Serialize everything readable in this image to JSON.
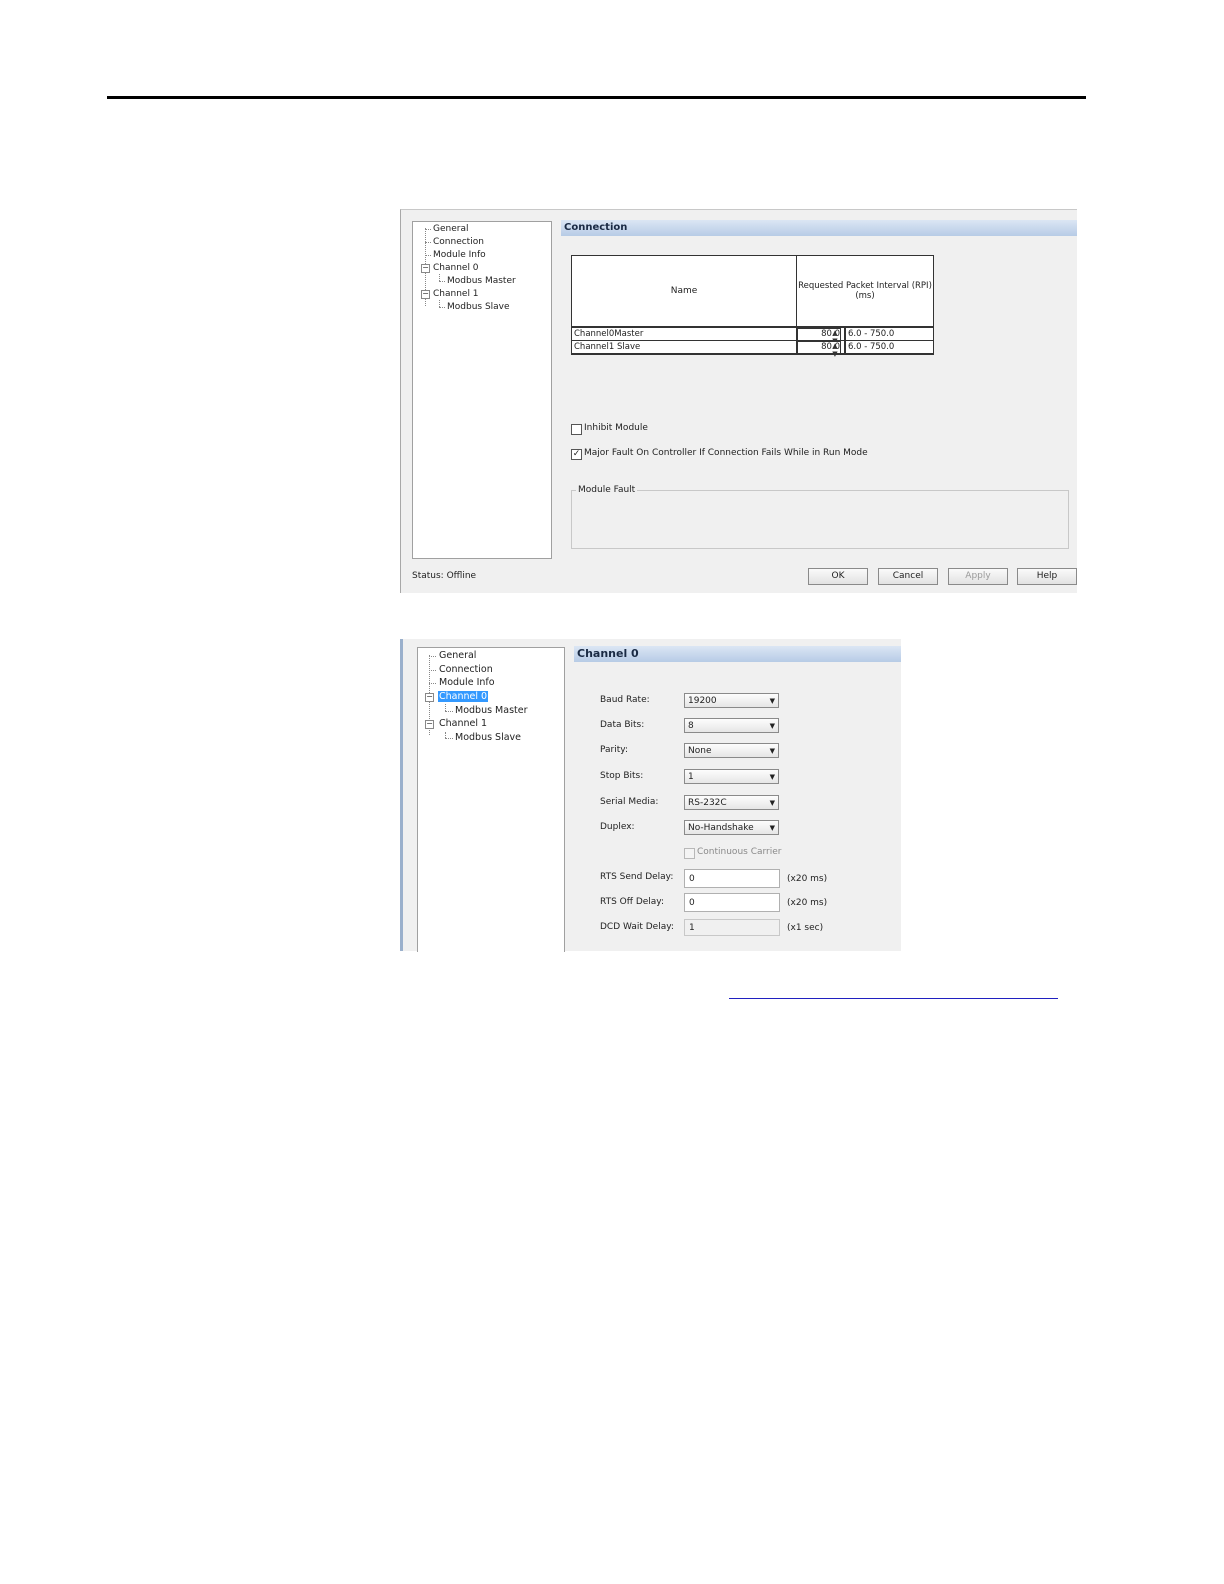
{
  "dialog1": {
    "tree": [
      {
        "label": "General"
      },
      {
        "label": "Connection"
      },
      {
        "label": "Module Info"
      },
      {
        "label": "Channel 0",
        "expander": "−"
      },
      {
        "label": "Modbus Master"
      },
      {
        "label": "Channel 1",
        "expander": "−"
      },
      {
        "label": "Modbus Slave"
      }
    ],
    "section_title": "Connection",
    "table": {
      "col_name": "Name",
      "col_rpi": "Requested Packet Interval (RPI)\n(ms)",
      "rows": [
        {
          "name": "Channel0Master",
          "value": "80.0",
          "range": "6.0 - 750.0"
        },
        {
          "name": "Channel1 Slave",
          "value": "80.0",
          "range": "6.0 - 750.0"
        }
      ]
    },
    "inhibit_label": "Inhibit Module",
    "inhibit_checked": false,
    "major_fault_label": "Major Fault On Controller If Connection Fails While in Run Mode",
    "major_fault_checked": true,
    "module_fault_label": "Module Fault",
    "status": "Status:  Offline",
    "buttons": {
      "ok": "OK",
      "cancel": "Cancel",
      "apply": "Apply",
      "help": "Help"
    }
  },
  "dialog2": {
    "tree": [
      {
        "label": "General"
      },
      {
        "label": "Connection"
      },
      {
        "label": "Module Info"
      },
      {
        "label": "Channel 0",
        "expander": "−",
        "selected": true
      },
      {
        "label": "Modbus Master"
      },
      {
        "label": "Channel 1",
        "expander": "−"
      },
      {
        "label": "Modbus Slave"
      }
    ],
    "section_title": "Channel 0",
    "fields": {
      "baud_rate": {
        "label": "Baud Rate:",
        "value": "19200"
      },
      "data_bits": {
        "label": "Data Bits:",
        "value": "8"
      },
      "parity": {
        "label": "Parity:",
        "value": "None"
      },
      "stop_bits": {
        "label": "Stop Bits:",
        "value": "1"
      },
      "serial_media": {
        "label": "Serial Media:",
        "value": "RS-232C"
      },
      "duplex": {
        "label": "Duplex:",
        "value": "No-Handshake"
      }
    },
    "continuous_carrier_label": "Continuous Carrier",
    "rts_send_delay": {
      "label": "RTS Send Delay:",
      "value": "0",
      "unit": "(x20 ms)"
    },
    "rts_off_delay": {
      "label": "RTS Off Delay:",
      "value": "0",
      "unit": "(x20 ms)"
    },
    "dcd_wait_delay": {
      "label": "DCD Wait Delay:",
      "value": "1",
      "unit": "(x1 sec)"
    }
  },
  "icons": {
    "dropdown": "▼",
    "spin": "▲▼",
    "check": "✓"
  }
}
